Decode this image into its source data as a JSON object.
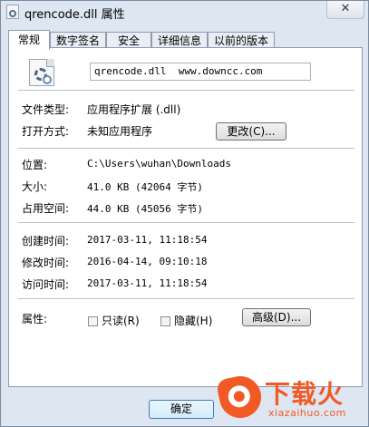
{
  "window": {
    "title": "qrencode.dll 属性",
    "close_label": "✕"
  },
  "tabs": [
    {
      "label": "常规",
      "active": true
    },
    {
      "label": "数字签名"
    },
    {
      "label": "安全"
    },
    {
      "label": "详细信息"
    },
    {
      "label": "以前的版本"
    }
  ],
  "general": {
    "file_name": "qrencode.dll  www.downcc.com",
    "file_type_label": "文件类型:",
    "file_type_value": "应用程序扩展 (.dll)",
    "opens_with_label": "打开方式:",
    "opens_with_value": "未知应用程序",
    "change_button": "更改(C)...",
    "location_label": "位置:",
    "location_value": "C:\\Users\\wuhan\\Downloads",
    "size_label": "大小:",
    "size_value": "41.0 KB (42064 字节)",
    "size_on_disk_label": "占用空间:",
    "size_on_disk_value": "44.0 KB (45056 字节)",
    "created_label": "创建时间:",
    "created_value": "2017-03-11, 11:18:54",
    "modified_label": "修改时间:",
    "modified_value": "2016-04-14, 09:10:18",
    "accessed_label": "访问时间:",
    "accessed_value": "2017-03-11, 11:18:54",
    "attributes_label": "属性:",
    "readonly_label": "只读(R)",
    "readonly_checked": false,
    "hidden_label": "隐藏(H)",
    "hidden_checked": false,
    "advanced_button": "高级(D)..."
  },
  "footer": {
    "ok_button": "确定"
  },
  "watermark": {
    "brand": "下载火",
    "domain": "xiazaihuo.com",
    "color": "#f15a24"
  }
}
